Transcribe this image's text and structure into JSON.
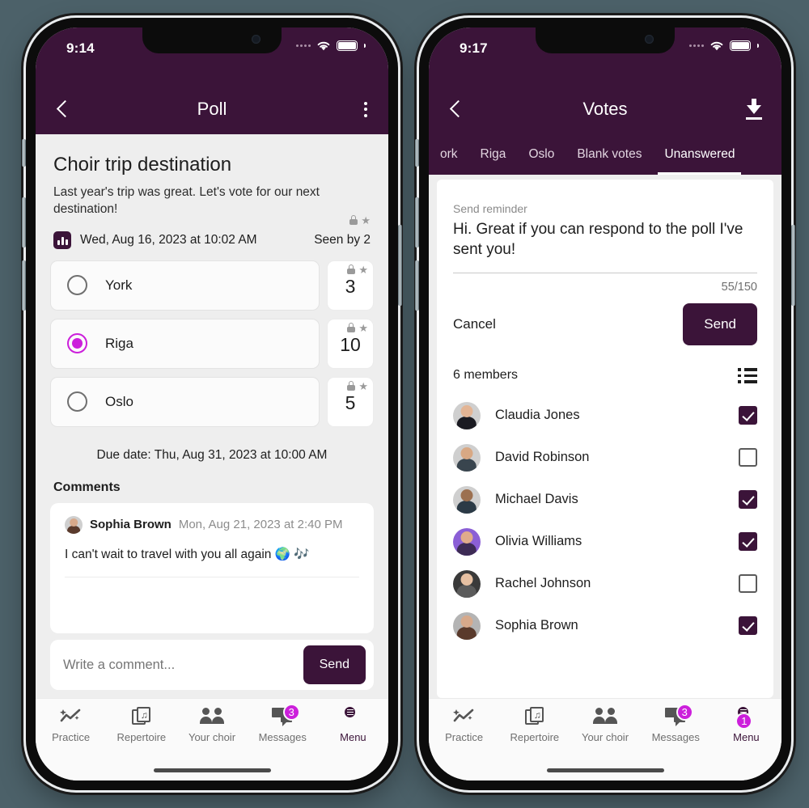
{
  "phone1": {
    "status": {
      "time": "9:14"
    },
    "header": {
      "title": "Poll",
      "back_icon": "chevron-left-icon",
      "menu_icon": "kebab-menu-icon"
    },
    "poll": {
      "title": "Choir trip destination",
      "description": "Last year's trip was great. Let's vote for our next destination!",
      "date": "Wed, Aug 16, 2023 at 10:02 AM",
      "seen_by": "Seen by 2",
      "due_date": "Due date: Thu, Aug 31, 2023 at 10:00 AM",
      "options": [
        {
          "label": "York",
          "votes": "3",
          "selected": false
        },
        {
          "label": "Riga",
          "votes": "10",
          "selected": true
        },
        {
          "label": "Oslo",
          "votes": "5",
          "selected": false
        }
      ]
    },
    "comments": {
      "heading": "Comments",
      "items": [
        {
          "author": "Sophia Brown",
          "time": "Mon, Aug 21, 2023 at 2:40 PM",
          "text": "I can't wait to travel with you all again 🌍 🎶"
        }
      ]
    },
    "composer": {
      "placeholder": "Write a comment...",
      "value": "",
      "send_label": "Send"
    },
    "bottom_nav": [
      {
        "label": "Practice",
        "icon": "practice-chart-icon",
        "badge": "",
        "active": false
      },
      {
        "label": "Repertoire",
        "icon": "music-sheets-icon",
        "badge": "",
        "active": false
      },
      {
        "label": "Your choir",
        "icon": "people-icon",
        "badge": "",
        "active": false
      },
      {
        "label": "Messages",
        "icon": "chat-bubbles-icon",
        "badge": "3",
        "active": false
      },
      {
        "label": "Menu",
        "icon": "avatar-menu-icon",
        "badge": "",
        "active": true
      }
    ]
  },
  "phone2": {
    "status": {
      "time": "9:17"
    },
    "header": {
      "title": "Votes",
      "back_icon": "chevron-left-icon",
      "action_icon": "download-icon"
    },
    "tabs": [
      {
        "label": "ork",
        "active": false
      },
      {
        "label": "Riga",
        "active": false
      },
      {
        "label": "Oslo",
        "active": false
      },
      {
        "label": "Blank votes",
        "active": false
      },
      {
        "label": "Unanswered",
        "active": true
      }
    ],
    "reminder": {
      "label": "Send reminder",
      "message": "Hi. Great if you can respond to the poll I've sent you!",
      "char_count": "55/150",
      "cancel_label": "Cancel",
      "send_label": "Send"
    },
    "members": {
      "count_label": "6 members",
      "list_icon": "list-view-icon",
      "items": [
        {
          "name": "Claudia Jones",
          "checked": true
        },
        {
          "name": "David Robinson",
          "checked": false
        },
        {
          "name": "Michael Davis",
          "checked": true
        },
        {
          "name": "Olivia Williams",
          "checked": true
        },
        {
          "name": "Rachel Johnson",
          "checked": false
        },
        {
          "name": "Sophia Brown",
          "checked": true
        }
      ]
    },
    "bottom_nav": [
      {
        "label": "Practice",
        "icon": "practice-chart-icon",
        "badge": "",
        "active": false
      },
      {
        "label": "Repertoire",
        "icon": "music-sheets-icon",
        "badge": "",
        "active": false
      },
      {
        "label": "Your choir",
        "icon": "people-icon",
        "badge": "",
        "active": false
      },
      {
        "label": "Messages",
        "icon": "chat-bubbles-icon",
        "badge": "3",
        "active": false
      },
      {
        "label": "Menu",
        "icon": "avatar-menu-icon",
        "badge": "1",
        "active": true
      }
    ]
  },
  "colors": {
    "header_purple": "#3b1439",
    "accent_magenta": "#cc1fdb",
    "page_background": "#4c6169",
    "screen_background": "#eeeeee"
  }
}
